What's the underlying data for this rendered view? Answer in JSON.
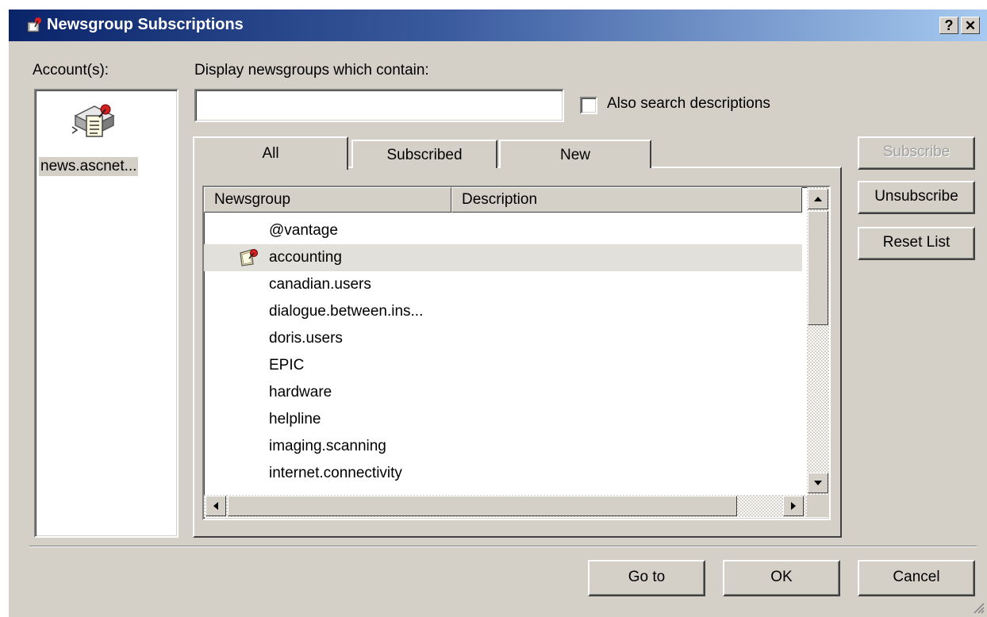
{
  "window": {
    "title": "Newsgroup Subscriptions",
    "help_glyph": "?",
    "close_glyph": "✕"
  },
  "accounts": {
    "label": "Account(s):",
    "items": [
      {
        "name": "news.ascnet...",
        "icon": "news-server-icon"
      }
    ]
  },
  "search": {
    "label": "Display newsgroups which contain:",
    "value": "",
    "checkbox_label": "Also search descriptions",
    "checkbox_checked": false
  },
  "tabs": [
    {
      "label": "All",
      "active": true
    },
    {
      "label": "Subscribed",
      "active": false
    },
    {
      "label": "New",
      "active": false
    }
  ],
  "list": {
    "columns": [
      "Newsgroup",
      "Description"
    ],
    "rows": [
      {
        "name": "@vantage",
        "subscribed": false,
        "selected": false
      },
      {
        "name": "accounting",
        "subscribed": true,
        "selected": true
      },
      {
        "name": "canadian.users",
        "subscribed": false,
        "selected": false
      },
      {
        "name": "dialogue.between.ins...",
        "subscribed": false,
        "selected": false
      },
      {
        "name": "doris.users",
        "subscribed": false,
        "selected": false
      },
      {
        "name": "EPIC",
        "subscribed": false,
        "selected": false
      },
      {
        "name": "hardware",
        "subscribed": false,
        "selected": false
      },
      {
        "name": "helpline",
        "subscribed": false,
        "selected": false
      },
      {
        "name": "imaging.scanning",
        "subscribed": false,
        "selected": false
      },
      {
        "name": "internet.connectivity",
        "subscribed": false,
        "selected": false
      }
    ]
  },
  "side_buttons": {
    "subscribe": "Subscribe",
    "unsubscribe": "Unsubscribe",
    "reset": "Reset List"
  },
  "footer_buttons": {
    "goto": "Go to",
    "ok": "OK",
    "cancel": "Cancel"
  },
  "colors": {
    "titlebar_start": "#0a246a",
    "titlebar_end": "#a6caf0",
    "dialog_bg": "#d4d0c8",
    "selected_row": "#e2e0da"
  }
}
